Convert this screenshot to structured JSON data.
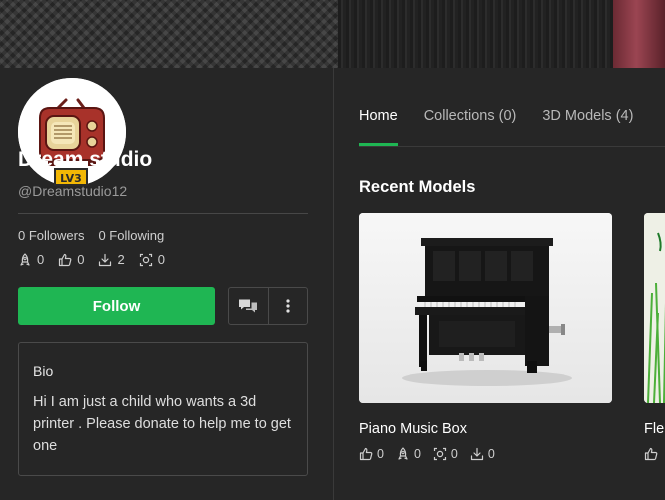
{
  "profile": {
    "name": "Dream studio",
    "handle": "@Dreamstudio12",
    "level_badge": "LV3",
    "followers": "0 Followers",
    "following": "0 Following",
    "stats": {
      "boosts": "0",
      "likes": "0",
      "downloads": "2",
      "prints": "0"
    }
  },
  "actions": {
    "follow_label": "Follow"
  },
  "bio": {
    "title": "Bio",
    "text": "Hi I am just a child who wants a 3d printer . Please donate to help me to get one"
  },
  "tabs": [
    {
      "label": "Home",
      "active": true
    },
    {
      "label": "Collections (0)",
      "active": false
    },
    {
      "label": "3D Models (4)",
      "active": false
    }
  ],
  "recent": {
    "title": "Recent Models",
    "models": [
      {
        "title": "Piano Music Box",
        "likes": "0",
        "boosts": "0",
        "prints": "0",
        "downloads": "0"
      },
      {
        "title": "Fle",
        "likes": "",
        "boosts": "",
        "prints": "",
        "downloads": ""
      }
    ]
  },
  "colors": {
    "accent": "#1fb653",
    "background": "#262626",
    "border": "#4a4a4a"
  }
}
